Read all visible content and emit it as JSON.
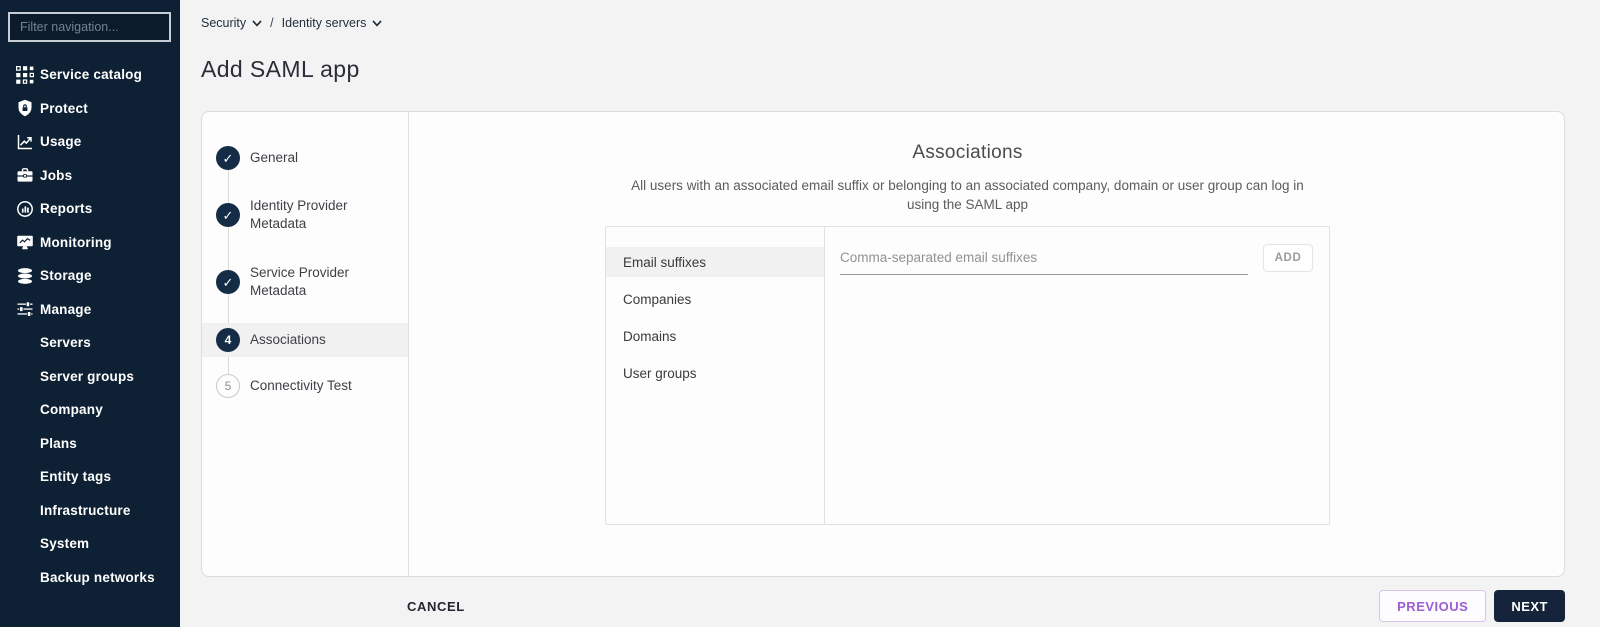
{
  "icons": {
    "check": "✓"
  },
  "colors": {
    "sidebar_bg": "#0e2033",
    "accent_purple": "#9c5fd2",
    "primary_dark": "#15243b",
    "step_circle": "#142c45",
    "row_highlight": "#f1f1f1",
    "page_bg": "#f4f3f4"
  },
  "sidebar": {
    "filter_placeholder": "Filter navigation...",
    "items": [
      {
        "label": "Service catalog",
        "icon": "service-catalog-icon"
      },
      {
        "label": "Protect",
        "icon": "shield-icon"
      },
      {
        "label": "Usage",
        "icon": "usage-chart-icon"
      },
      {
        "label": "Jobs",
        "icon": "briefcase-icon"
      },
      {
        "label": "Reports",
        "icon": "reports-icon"
      },
      {
        "label": "Monitoring",
        "icon": "monitor-icon"
      },
      {
        "label": "Storage",
        "icon": "database-icon"
      },
      {
        "label": "Manage",
        "icon": "sliders-icon"
      },
      {
        "label": "Servers",
        "icon": ""
      },
      {
        "label": "Server groups",
        "icon": ""
      },
      {
        "label": "Company",
        "icon": ""
      },
      {
        "label": "Plans",
        "icon": ""
      },
      {
        "label": "Entity tags",
        "icon": ""
      },
      {
        "label": "Infrastructure",
        "icon": ""
      },
      {
        "label": "System",
        "icon": ""
      },
      {
        "label": "Backup networks",
        "icon": ""
      }
    ]
  },
  "breadcrumb": {
    "first": "Security",
    "separator": "/",
    "second": "Identity servers"
  },
  "page_title": "Add SAML app",
  "wizard": {
    "steps": [
      {
        "label": "General",
        "state": "done"
      },
      {
        "label": "Identity Provider Metadata",
        "state": "done"
      },
      {
        "label": "Service Provider Metadata",
        "state": "done"
      },
      {
        "label": "Associations",
        "state": "active",
        "number": "4"
      },
      {
        "label": "Connectivity Test",
        "state": "pending",
        "number": "5"
      }
    ]
  },
  "associations": {
    "heading": "Associations",
    "description": "All users with an associated email suffix or belonging to an associated company, domain or user group can log in using the SAML app",
    "tabs": [
      "Email suffixes",
      "Companies",
      "Domains",
      "User groups"
    ],
    "selected_tab": "Email suffixes",
    "input_placeholder": "Comma-separated email suffixes",
    "input_value": "",
    "add_label": "ADD"
  },
  "footer": {
    "cancel_label": "CANCEL",
    "previous_label": "PREVIOUS",
    "next_label": "NEXT"
  }
}
